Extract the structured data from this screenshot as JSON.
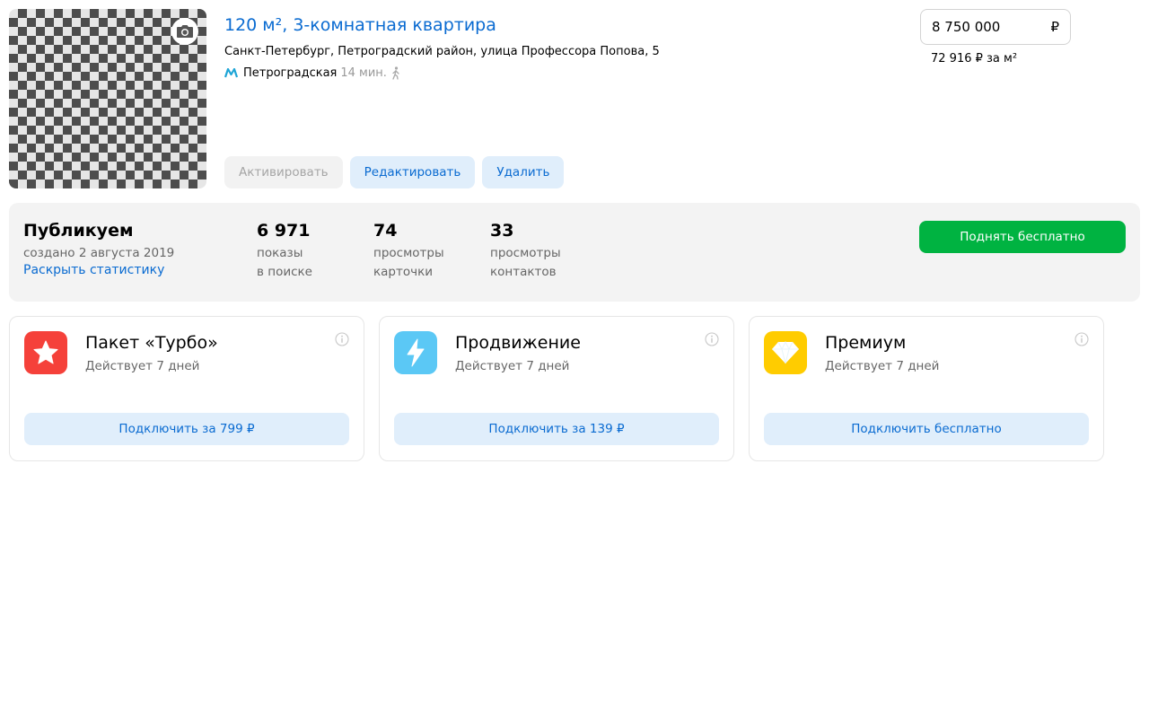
{
  "offer": {
    "title": "120 м², 3-комнатная квартира",
    "address": "Санкт-Петербург, Петроградский район, улица Профессора Попова, 5",
    "metro": {
      "station": "Петроградская",
      "time": "14 мин.",
      "line_color": "#1ea5d6"
    },
    "actions": {
      "activate": "Активировать",
      "edit": "Редактировать",
      "delete": "Удалить"
    },
    "price": {
      "value": "8 750 000",
      "currency": "₽",
      "per_sqm": "72 916 ₽ за м²"
    }
  },
  "stats": {
    "status": "Публикуем",
    "created": "создано 2 августа 2019",
    "expand_link": "Раскрыть статистику",
    "items": [
      {
        "value": "6 971",
        "label_line1": "показы",
        "label_line2": "в поиске"
      },
      {
        "value": "74",
        "label_line1": "просмотры",
        "label_line2": "карточки"
      },
      {
        "value": "33",
        "label_line1": "просмотры",
        "label_line2": "контактов"
      }
    ],
    "raise_button": "Поднять бесплатно"
  },
  "services": [
    {
      "name": "Пакет «Турбо»",
      "duration": "Действует 7 дней",
      "button": "Подключить за 799 ₽",
      "icon": "star-icon",
      "color": "#f5413a"
    },
    {
      "name": "Продвижение",
      "duration": "Действует 7 дней",
      "button": "Подключить за 139 ₽",
      "icon": "lightning-icon",
      "color": "#5bc8f5"
    },
    {
      "name": "Премиум",
      "duration": "Действует 7 дней",
      "button": "Подключить бесплатно",
      "icon": "diamond-icon",
      "color": "#ffcc00"
    }
  ],
  "colors": {
    "link": "#0a6bd1",
    "accent_green": "#00b341",
    "light_button": "#e0eefb"
  }
}
